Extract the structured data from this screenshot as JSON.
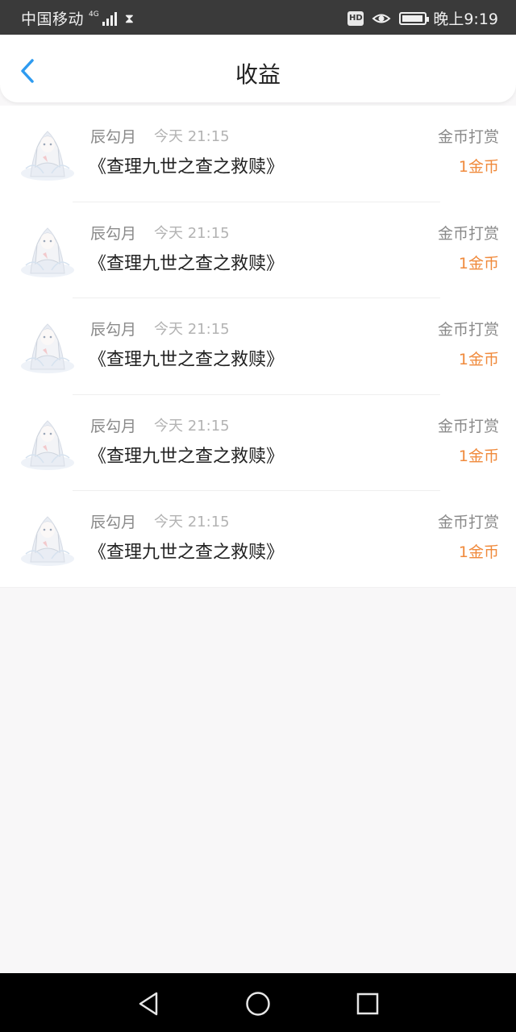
{
  "status_bar": {
    "carrier": "中国移动",
    "network": "4G",
    "clock": "晚上9:19",
    "hd_label": "HD",
    "battery_level": 0.95
  },
  "header": {
    "title": "收益"
  },
  "records": [
    {
      "name": "辰勾月",
      "time": "今天 21:15",
      "book": "《查理九世之查之救赎》",
      "type": "金币打赏",
      "amount": "1金币"
    },
    {
      "name": "辰勾月",
      "time": "今天 21:15",
      "book": "《查理九世之查之救赎》",
      "type": "金币打赏",
      "amount": "1金币"
    },
    {
      "name": "辰勾月",
      "time": "今天 21:15",
      "book": "《查理九世之查之救赎》",
      "type": "金币打赏",
      "amount": "1金币"
    },
    {
      "name": "辰勾月",
      "time": "今天 21:15",
      "book": "《查理九世之查之救赎》",
      "type": "金币打赏",
      "amount": "1金币"
    },
    {
      "name": "辰勾月",
      "time": "今天 21:15",
      "book": "《查理九世之查之救赎》",
      "type": "金币打赏",
      "amount": "1金币"
    }
  ],
  "colors": {
    "accent": "#2e9bf0",
    "amount": "#f08a3c",
    "status_bar": "#3a3a3a"
  },
  "icons": {
    "back": "chevron-left-icon",
    "nav_back": "triangle-back-icon",
    "nav_home": "circle-home-icon",
    "nav_recent": "square-recent-icon"
  }
}
